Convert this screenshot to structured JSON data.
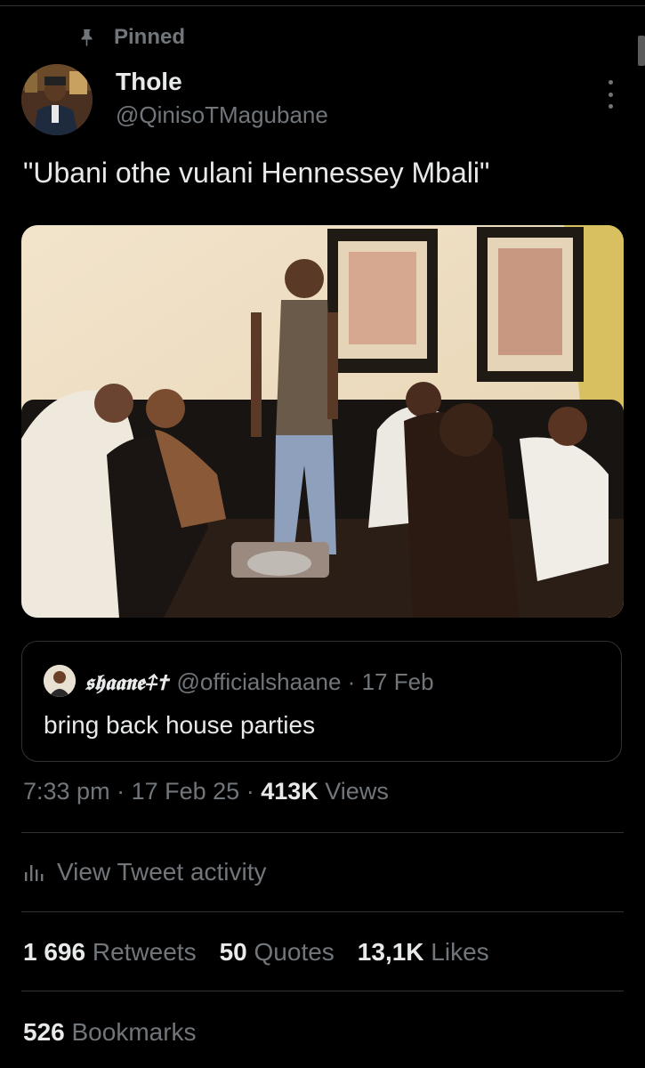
{
  "pinned_label": "Pinned",
  "author": {
    "name": "Thole",
    "handle": "@QinisoTMagubane"
  },
  "tweet_text": "\"Ubani othe vulani Hennessey Mbali\"",
  "quoted": {
    "name": "𝖘𝖍𝖆𝖆𝖓𝖊",
    "name_symbols": "⍏✝",
    "handle": "@officialshaane",
    "separator": "·",
    "date": "17 Feb",
    "text": "bring back house parties"
  },
  "meta": {
    "time": "7:33 pm",
    "dot1": "·",
    "date": "17 Feb 25",
    "dot2": "·",
    "views_count": "413K",
    "views_label": "Views"
  },
  "activity_label": "View Tweet activity",
  "stats": {
    "retweets_count": "1 696",
    "retweets_label": "Retweets",
    "quotes_count": "50",
    "quotes_label": "Quotes",
    "likes_count": "13,1K",
    "likes_label": "Likes",
    "bookmarks_count": "526",
    "bookmarks_label": "Bookmarks"
  },
  "icons": [
    "pin-icon",
    "more-icon",
    "analytics-icon"
  ],
  "colors": {
    "background": "#000000",
    "text_primary": "#e7e9ea",
    "text_secondary": "#71767b",
    "border": "#2f3336"
  }
}
